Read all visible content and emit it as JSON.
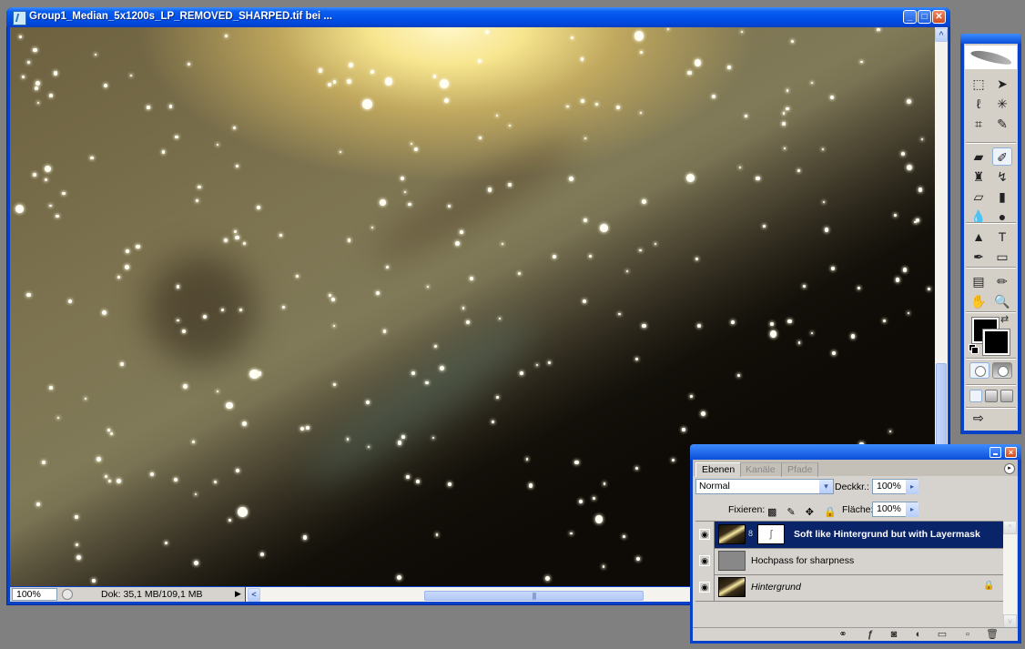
{
  "document_window": {
    "title": "Group1_Median_5x1200s_LP_REMOVED_SHARPED.tif bei ...",
    "controls": {
      "minimize": "_",
      "maximize": "□",
      "close": "✕"
    },
    "status": {
      "zoom": "100%",
      "doc_size": "Dok: 35,1 MB/109,1 MB",
      "menu_arrow": "▶"
    },
    "scroll_arrows": {
      "up": "^",
      "left": "<"
    },
    "hthumb_grip": "||||",
    "image_description": "Astrophotograph of a spiral galaxy arm with dense star field"
  },
  "toolbox": {
    "tools": [
      {
        "name": "marquee-tool",
        "glyph": "⬚"
      },
      {
        "name": "move-tool",
        "glyph": "➤"
      },
      {
        "name": "lasso-tool",
        "glyph": "ℓ"
      },
      {
        "name": "magic-wand-tool",
        "glyph": "✳"
      },
      {
        "name": "crop-tool",
        "glyph": "⌗"
      },
      {
        "name": "slice-tool",
        "glyph": "✎"
      },
      {
        "name": "healing-brush-tool",
        "glyph": "▰"
      },
      {
        "name": "brush-tool",
        "glyph": "✐"
      },
      {
        "name": "clone-stamp-tool",
        "glyph": "♜"
      },
      {
        "name": "history-brush-tool",
        "glyph": "↯"
      },
      {
        "name": "eraser-tool",
        "glyph": "▱"
      },
      {
        "name": "gradient-tool",
        "glyph": "▮"
      },
      {
        "name": "blur-tool",
        "glyph": "💧"
      },
      {
        "name": "dodge-tool",
        "glyph": "●"
      },
      {
        "name": "path-selection-tool",
        "glyph": "▲"
      },
      {
        "name": "type-tool",
        "glyph": "T"
      },
      {
        "name": "pen-tool",
        "glyph": "✒"
      },
      {
        "name": "shape-tool",
        "glyph": "▭"
      },
      {
        "name": "notes-tool",
        "glyph": "▤"
      },
      {
        "name": "eyedropper-tool",
        "glyph": "✏"
      },
      {
        "name": "hand-tool",
        "glyph": "✋"
      },
      {
        "name": "zoom-tool",
        "glyph": "🔍"
      }
    ],
    "active_tool": "brush-tool",
    "foreground_color": "#000000",
    "background_color": "#000000",
    "swap_glyph": "⇄",
    "jump_glyph": "⇨"
  },
  "layers_panel": {
    "tabs": [
      "Ebenen",
      "Kanäle",
      "Pfade"
    ],
    "active_tab": "Ebenen",
    "blend_mode": "Normal",
    "opacity_label": "Deckkr.:",
    "opacity": "100%",
    "lock_label": "Fixieren:",
    "lock_glyphs": "▩ ✎ ✥ 🔒",
    "fill_label": "Fläche:",
    "fill": "100%",
    "dropdown_glyph": "▾",
    "arrow_glyph": "▸",
    "menu_glyph": "▸",
    "layers": [
      {
        "name": "Soft like Hintergrund but with Layermask",
        "visible": true,
        "selected": true,
        "has_mask": true,
        "locked": false
      },
      {
        "name": "Hochpass for sharpness",
        "visible": true,
        "selected": false,
        "has_mask": false,
        "locked": false
      },
      {
        "name": "Hintergrund",
        "visible": true,
        "selected": false,
        "has_mask": false,
        "locked": true
      }
    ],
    "eye_glyph": "◉",
    "chain_glyph": "8",
    "mask_glyph": "ʃ",
    "lock_glyph": "🔒",
    "scroll_up": "^",
    "scroll_down": "v",
    "footer": {
      "link": "⚭",
      "style": "ƒ",
      "mask": "◙",
      "adjust": "◐",
      "group": "▭",
      "new": "▫",
      "delete": "🗑"
    }
  }
}
